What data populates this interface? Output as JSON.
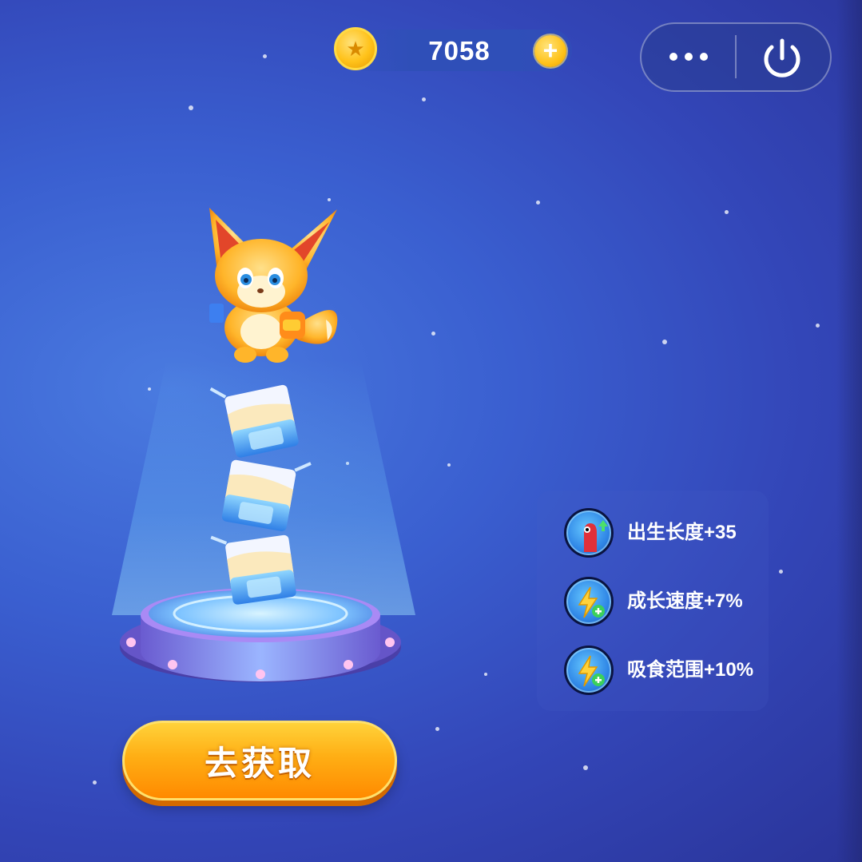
{
  "hud": {
    "coins": "7058",
    "coin_add_label": "+"
  },
  "get_button": {
    "label": "去获取"
  },
  "attributes": [
    {
      "icon": "snake-grow-icon",
      "text": "出生长度+35"
    },
    {
      "icon": "lightning-plus-icon",
      "text": "成长速度+7%"
    },
    {
      "icon": "lightning-plus-icon",
      "text": "吸食范围+10%"
    }
  ],
  "colors": {
    "background": "#3a5fd0",
    "button_orange": "#ffae14",
    "coin_gold": "#ffc21a"
  }
}
